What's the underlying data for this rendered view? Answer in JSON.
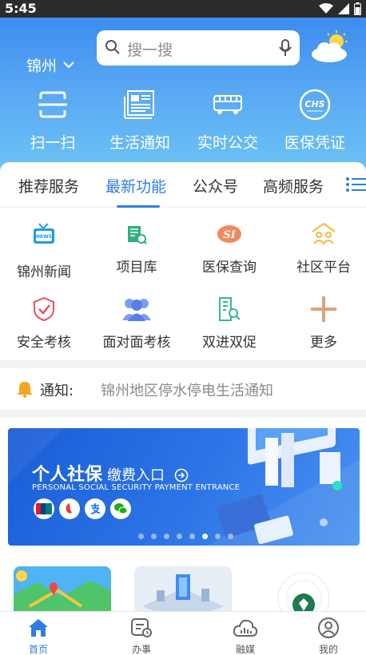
{
  "status_bar": {
    "time": "5:45"
  },
  "header": {
    "city": "锦州",
    "search_placeholder": "搜一搜",
    "quick_actions": [
      {
        "label": "扫一扫",
        "icon": "scan-icon"
      },
      {
        "label": "生活通知",
        "icon": "newspaper-icon"
      },
      {
        "label": "实时公交",
        "icon": "bus-icon"
      },
      {
        "label": "医保凭证",
        "icon": "chs-icon"
      }
    ]
  },
  "tabs": {
    "items": [
      "推荐服务",
      "最新功能",
      "公众号",
      "高频服务"
    ],
    "active": "最新功能"
  },
  "services": [
    {
      "label": "锦州新闻",
      "icon": "news-tv-icon"
    },
    {
      "label": "项目库",
      "icon": "project-library-icon"
    },
    {
      "label": "医保查询",
      "icon": "si-icon"
    },
    {
      "label": "社区平台",
      "icon": "community-icon"
    },
    {
      "label": "安全考核",
      "icon": "shield-check-icon"
    },
    {
      "label": "面对面考核",
      "icon": "people-icon"
    },
    {
      "label": "双进双促",
      "icon": "building-search-icon"
    },
    {
      "label": "更多",
      "icon": "plus-icon"
    }
  ],
  "notice": {
    "label": "通知:",
    "text": "锦州地区停水停电生活通知"
  },
  "banner": {
    "title": "个人社保",
    "title_suffix": "缴费入口",
    "subtitle": "PERSONAL SOCIAL SECURITY PAYMENT ENTRANCE",
    "dot_count": 8,
    "active_dot": 5
  },
  "bottom_nav": [
    {
      "label": "首页",
      "icon": "home-icon",
      "active": true
    },
    {
      "label": "办事",
      "icon": "task-icon",
      "active": false
    },
    {
      "label": "融媒",
      "icon": "cloud-media-icon",
      "active": false
    },
    {
      "label": "我的",
      "icon": "profile-icon",
      "active": false
    }
  ],
  "colors": {
    "accent": "#2f7de1",
    "header_top": "#3d8cf0",
    "header_bottom": "#6ec6f4",
    "banner": "#2b73e6"
  }
}
